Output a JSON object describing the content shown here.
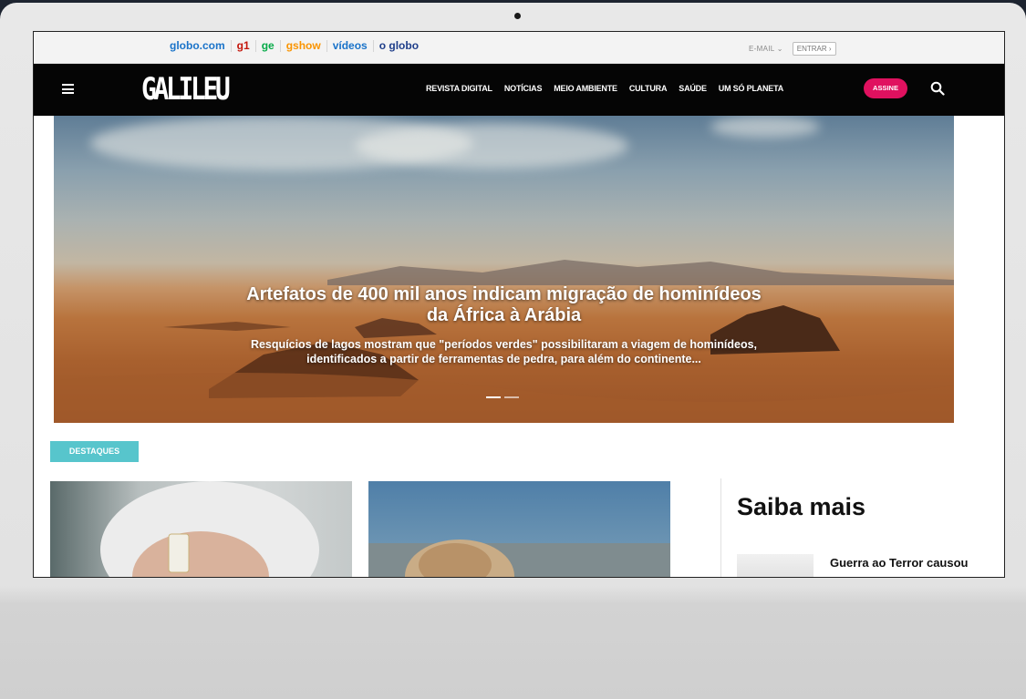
{
  "globo_bar": {
    "links": [
      {
        "label": "globo.com",
        "color": "#1a73c9"
      },
      {
        "label": "g1",
        "color": "#c4170c"
      },
      {
        "label": "ge",
        "color": "#06aa48"
      },
      {
        "label": "gshow",
        "color": "#fa9400"
      },
      {
        "label": "vídeos",
        "color": "#1a73c9"
      },
      {
        "label": "o globo",
        "color": "#1f3e8a"
      }
    ],
    "email_label": "E-MAIL",
    "login_label": "ENTRAR"
  },
  "nav": {
    "logo": "GALILEU",
    "menu": [
      "REVISTA DIGITAL",
      "NOTÍCIAS",
      "MEIO AMBIENTE",
      "CULTURA",
      "SAÚDE",
      "UM SÓ PLANETA"
    ],
    "subscribe_label": "ASSINE",
    "accent_color": "#e0115f"
  },
  "hero": {
    "title": "Artefatos de 400 mil anos indicam migração de hominídeos da África à Arábia",
    "subtitle": "Resquícios de lagos mostram que \"períodos verdes\" possibilitaram a viagem de hominídeos, identificados a partir de ferramentas de pedra, para além do continente..."
  },
  "section": {
    "label": "DESTAQUES",
    "label_color": "#57c5cc"
  },
  "sidebar": {
    "heading": "Saiba mais",
    "item_title": "Guerra ao Terror causou"
  }
}
